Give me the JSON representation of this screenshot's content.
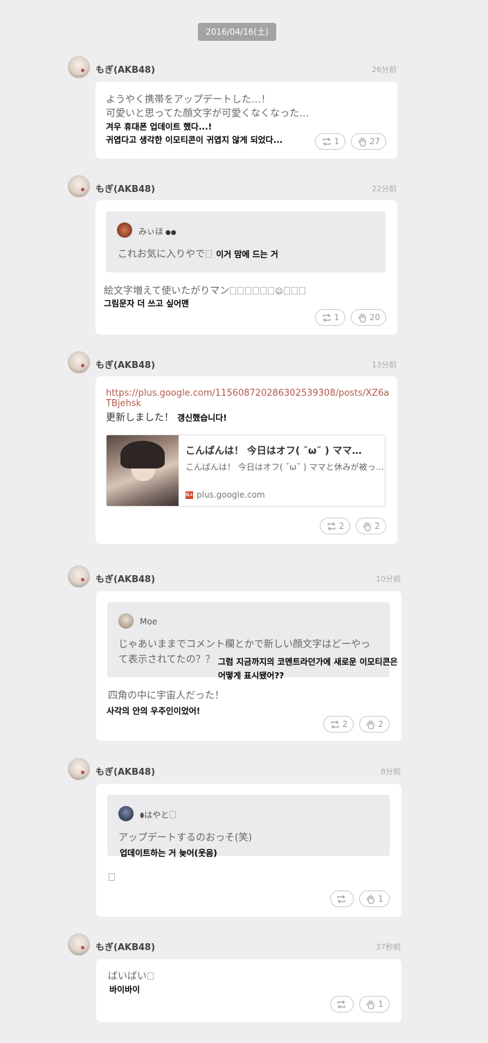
{
  "date_label": "2016/04/16(土)",
  "posts": [
    {
      "user": "もぎ(AKB48)",
      "time": "26分前",
      "jp_line1": "ようやく携帯をアップデートした…！",
      "jp_line2": "可愛いと思ってた顔文字が可愛くなくなった…",
      "kr_line1": "겨우 휴대폰 업데이트 했다...!",
      "kr_line2": "귀엽다고 생각한 이모티콘이 귀엽지 않게 되었다...",
      "retweets": "1",
      "likes": "27"
    },
    {
      "user": "もぎ(AKB48)",
      "time": "22分前",
      "quote_user": "みぃほ",
      "quote_jp": "これお気に入りやで",
      "quote_kr": "이거 맘에 드는 거",
      "jp_line1": "絵文字増えて使いたがりマン",
      "kr_line1": "그림문자 더 쓰고 싶어맨",
      "retweets": "1",
      "likes": "20"
    },
    {
      "user": "もぎ(AKB48)",
      "time": "13分前",
      "link_text": "https://plus.google.com/115608720286302539308/posts/XZ6aTBjehsk",
      "jp_line1": "更新しました！",
      "kr_line1": "갱신했습니다!",
      "card_title": "こんばんは！ 今日はオフ( ˘ω˘ ) ママ…",
      "card_desc": "こんばんは！ 今日はオフ( ˘ω˘ ) ママと休みが被っ…",
      "card_domain": "plus.google.com",
      "retweets": "2",
      "likes": "2"
    },
    {
      "user": "もぎ(AKB48)",
      "time": "10分前",
      "quote_user": "Moe",
      "quote_jp1": "じゃあいままでコメント欄とかで新しい顔文字はどーやっ",
      "quote_jp2": "て表示されてたの？？",
      "quote_kr1": "그럼 지금까지의 코멘트라던가에 새로운 이모티콘은",
      "quote_kr2": "어떻게 표시됐어??",
      "jp_line1": "四角の中に宇宙人だった！",
      "kr_line1": "사각의 안의 우주인이었어!",
      "retweets": "2",
      "likes": "2"
    },
    {
      "user": "もぎ(AKB48)",
      "time": "8分前",
      "quote_user": "はやと",
      "quote_jp": "アップデートするのおっそ(笑)",
      "quote_kr": "업데이트하는 거 늦어(웃음)",
      "retweets": "",
      "likes": "1"
    },
    {
      "user": "もぎ(AKB48)",
      "time": "37秒前",
      "jp_line1": "ばいばい",
      "kr_line1": "바이바이",
      "retweets": "",
      "likes": "1"
    }
  ]
}
